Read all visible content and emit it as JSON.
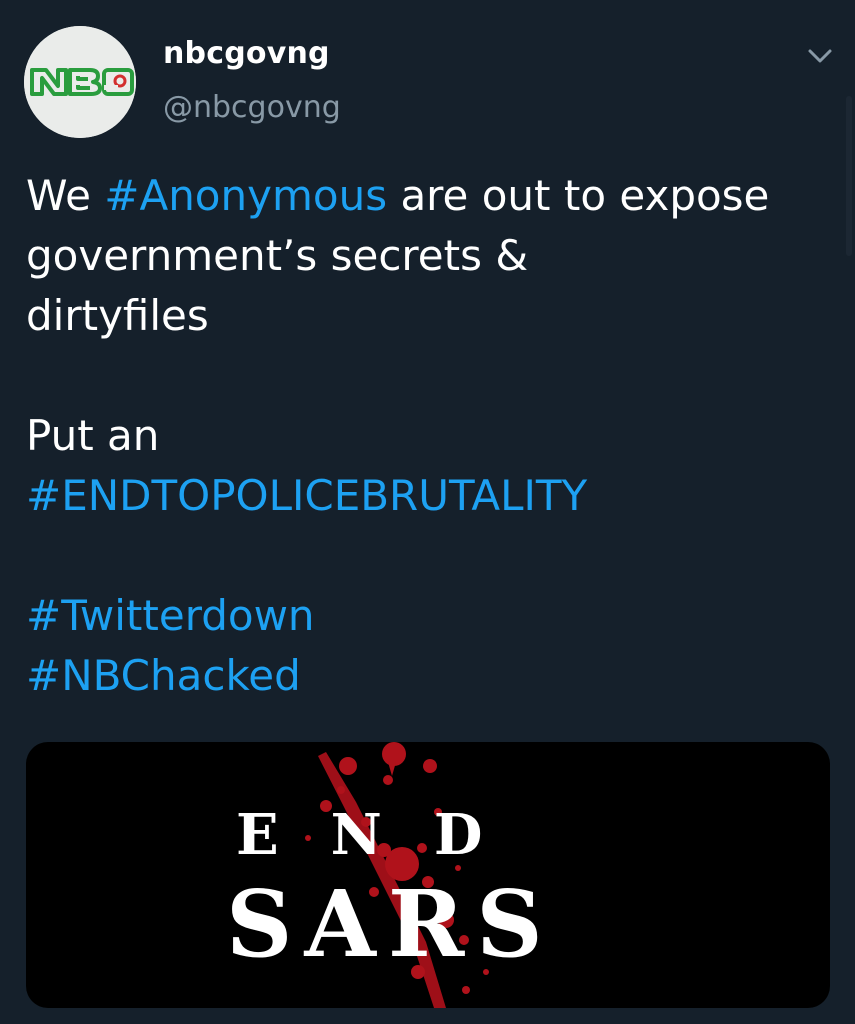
{
  "account": {
    "display_name": "nbcgovng",
    "handle": "@nbcgovng",
    "avatar_logo_text": "NBC"
  },
  "menu": {
    "icon": "chevron-down-icon"
  },
  "tweet": {
    "line1_pre": "We ",
    "line1_tag": "#Anonymous",
    "line1_post": " are out to expose",
    "line2": "government’s secrets &",
    "line3": "dirtyfiles",
    "line4": "Put an",
    "tag_endto": "#ENDTOPOLICEBRUTALITY",
    "tag_twitterdown": "#Twitterdown",
    "tag_nbchacked": "#NBChacked"
  },
  "media": {
    "word_top": "END",
    "word_bottom": "SARS"
  },
  "colors": {
    "background": "#15202b",
    "text": "#ffffff",
    "secondary_text": "#8899a6",
    "hashtag": "#1da1f2",
    "logo_green": "#2a9d3e",
    "logo_red": "#d32f2f",
    "blood_red": "#b0121b"
  }
}
